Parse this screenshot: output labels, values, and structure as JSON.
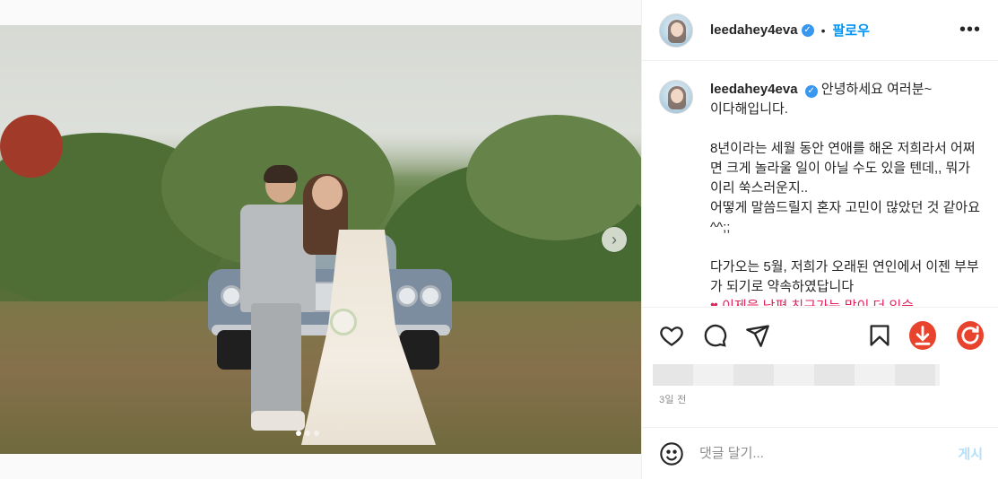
{
  "post": {
    "username": "leedahey4eva",
    "follow_label": "팔로우",
    "separator": "•",
    "more_label": "•••",
    "caption_line1": "안녕하세요 여러분~",
    "caption_rest": "이다해입니다.\n\n8년이라는 세월 동안 연애를 해온 저희라서 어쩌면 크게 놀라울 일이 아닐 수도 있을 텐데,, 뭐가 이리 쑥스러운지..\n어떻게 말씀드릴지 혼자 고민이 많았던 것 같아요 ^^;;\n\n다가오는 5월, 저희가 오래된 연인에서 이젠 부부가 되기로 약속하였답니다",
    "caption_tail": "♥ 이제을 남편 친구가는 많이 더 있습",
    "date": "3일 전",
    "verified_glyph": "✓",
    "next_glyph": "›"
  },
  "carousel": {
    "count": 3,
    "active_index": 0
  },
  "actions": {
    "icons": [
      "heart-icon",
      "comment-icon",
      "share-icon",
      "bookmark-icon",
      "download-icon",
      "refresh-icon"
    ]
  },
  "comment": {
    "placeholder": "댓글 달기...",
    "post_label": "게시"
  },
  "colors": {
    "accent": "#0095f6",
    "download": "#e8432c",
    "refresh": "#e8432c"
  }
}
